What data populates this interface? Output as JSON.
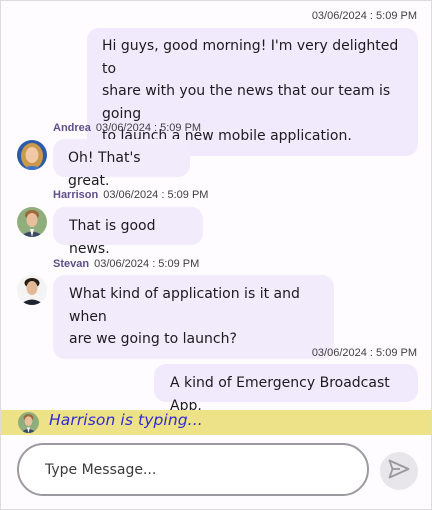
{
  "messages": [
    {
      "direction": "outgoing",
      "timestamp": "03/06/2024 : 5:09 PM",
      "text_lines": [
        "Hi guys, good morning! I'm very delighted to",
        "share with you the news that our team is going",
        "to launch a new mobile application."
      ]
    },
    {
      "direction": "incoming",
      "author": "Andrea",
      "timestamp": "03/06/2024 : 5:09 PM",
      "text_lines": [
        "Oh! That's great."
      ]
    },
    {
      "direction": "incoming",
      "author": "Harrison",
      "timestamp": "03/06/2024 : 5:09 PM",
      "text_lines": [
        "That is good news."
      ]
    },
    {
      "direction": "incoming",
      "author": "Stevan",
      "timestamp": "03/06/2024 : 5:09 PM",
      "text_lines": [
        "What kind of application is it and when",
        "are we going to launch?"
      ]
    },
    {
      "direction": "outgoing",
      "timestamp": "03/06/2024 : 5:09 PM",
      "text_lines": [
        "A kind of Emergency Broadcast App."
      ]
    }
  ],
  "typing_indicator": {
    "text": "Harrison is typing..."
  },
  "composer": {
    "placeholder": "Type Message...",
    "value": ""
  },
  "colors": {
    "bubble": "#f1ebfb",
    "author_name": "#5c4f8a",
    "typing_bar": "#eee288",
    "typing_text": "#2e2ad8"
  }
}
